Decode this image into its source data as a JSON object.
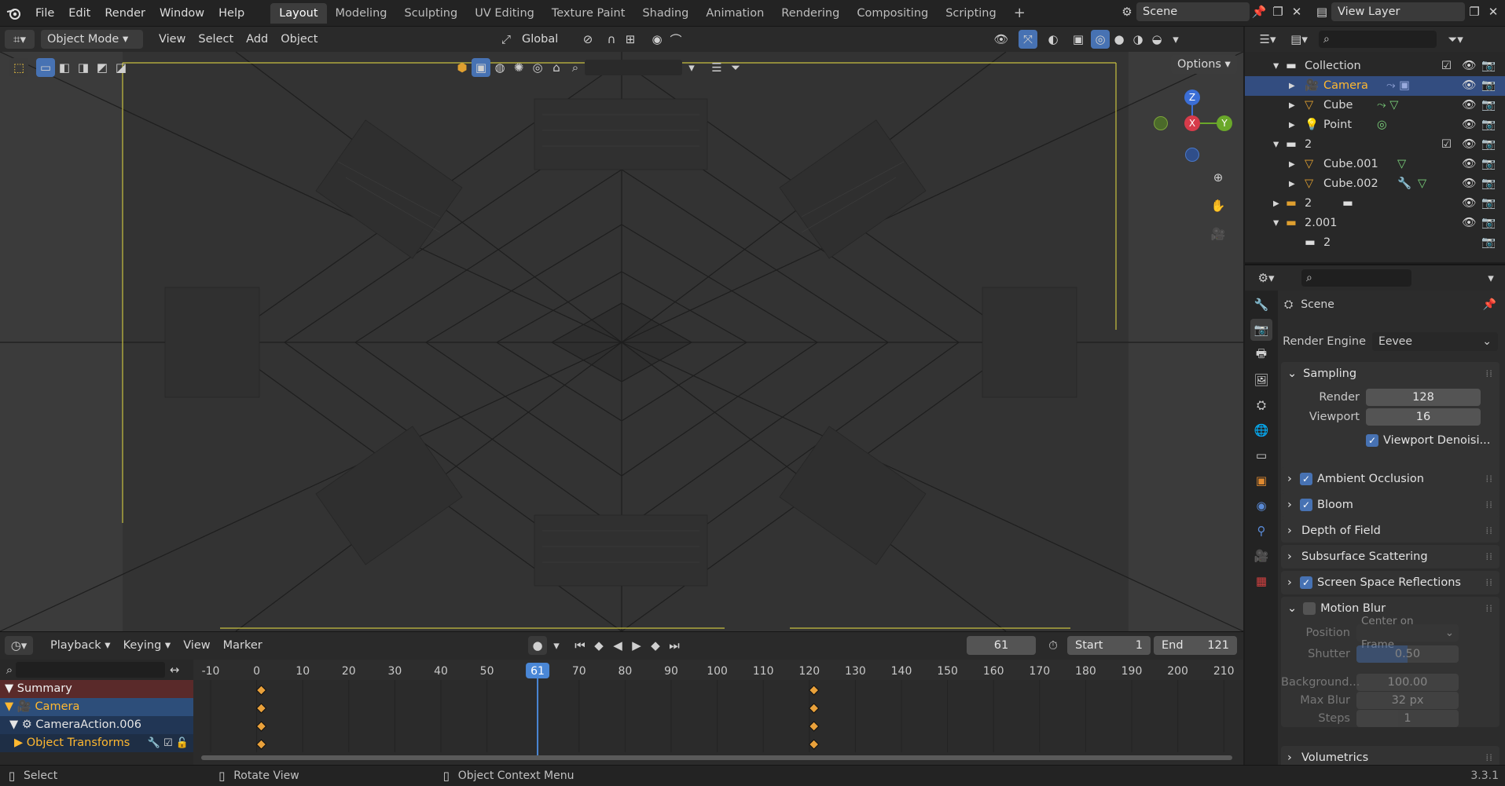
{
  "topbar": {
    "menus": [
      "File",
      "Edit",
      "Render",
      "Window",
      "Help"
    ],
    "workspaces": [
      "Layout",
      "Modeling",
      "Sculpting",
      "UV Editing",
      "Texture Paint",
      "Shading",
      "Animation",
      "Rendering",
      "Compositing",
      "Scripting"
    ],
    "active_workspace": "Layout",
    "add_tab": "+",
    "scene": "Scene",
    "view_layer": "View Layer"
  },
  "viewport_header": {
    "mode": "Object Mode",
    "menus": [
      "View",
      "Select",
      "Add",
      "Object"
    ],
    "orientation": "Global",
    "options": "Options"
  },
  "gizmo": {
    "z": "Z",
    "x": "X",
    "y": "Y"
  },
  "timeline": {
    "menus": [
      "Playback",
      "Keying",
      "View",
      "Marker"
    ],
    "current_frame": "61",
    "start_label": "Start",
    "start_value": "1",
    "end_label": "End",
    "end_value": "121",
    "ruler": [
      "-10",
      "0",
      "10",
      "20",
      "30",
      "40",
      "50",
      "61",
      "70",
      "80",
      "90",
      "100",
      "110",
      "120",
      "130",
      "140",
      "150",
      "160",
      "170",
      "180",
      "190",
      "200",
      "210"
    ],
    "channels": [
      {
        "label": "Summary"
      },
      {
        "label": "Camera"
      },
      {
        "label": "CameraAction.006"
      },
      {
        "label": "Object Transforms"
      }
    ]
  },
  "statusbar": {
    "select": "Select",
    "rotate": "Rotate View",
    "context": "Object Context Menu",
    "version": "3.3.1"
  },
  "outliner": {
    "rows": [
      {
        "label": "Collection"
      },
      {
        "label": "Camera"
      },
      {
        "label": "Cube"
      },
      {
        "label": "Point"
      },
      {
        "label": "2"
      },
      {
        "label": "Cube.001"
      },
      {
        "label": "Cube.002"
      },
      {
        "label": "2"
      },
      {
        "label": "2.001"
      },
      {
        "label": "2"
      }
    ]
  },
  "properties": {
    "context": "Scene",
    "render_engine_label": "Render Engine",
    "render_engine": "Eevee",
    "sampling": "Sampling",
    "render_label": "Render",
    "render_value": "128",
    "viewport_label": "Viewport",
    "viewport_value": "16",
    "denoise": "Viewport Denoisi...",
    "panels": [
      "Ambient Occlusion",
      "Bloom",
      "Depth of Field",
      "Subsurface Scattering",
      "Screen Space Reflections",
      "Motion Blur"
    ],
    "position_label": "Position",
    "position_value": "Center on Frame",
    "shutter_label": "Shutter",
    "shutter_value": "0.50",
    "shutter_fraction": 0.5,
    "background_label": "Background...",
    "background_value": "100.00",
    "maxblur_label": "Max Blur",
    "maxblur_value": "32 px",
    "steps_label": "Steps",
    "steps_value": "1",
    "volumetrics": "Volumetrics"
  },
  "colors": {
    "accent": "#4772b3",
    "selection": "#334d80",
    "keyframe": "#e9a13b",
    "playhead": "#4a87d6",
    "summary_bg": "#5a2a2a",
    "camera_bg": "#2d4e7a"
  }
}
